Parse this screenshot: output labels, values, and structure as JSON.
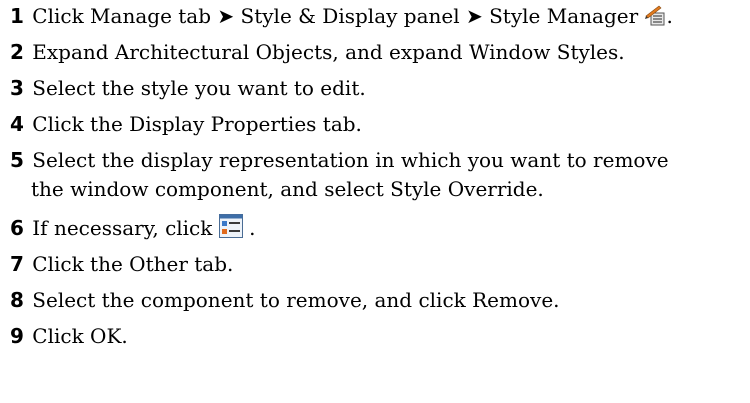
{
  "steps": [
    {
      "number": "1",
      "parts": [
        "Click Manage tab",
        "Style & Display panel",
        "Style Manager",
        "."
      ],
      "separator": "➤",
      "icon": "style-manager-icon"
    },
    {
      "number": "2",
      "text": "Expand Architectural Objects, and expand Window Styles."
    },
    {
      "number": "3",
      "text": "Select the style you want to edit."
    },
    {
      "number": "4",
      "text": "Click the Display Properties tab."
    },
    {
      "number": "5",
      "line1": "Select the display representation in which you want to remove",
      "line2": "the window component, and select Style Override."
    },
    {
      "number": "6",
      "text": "If necessary, click",
      "suffix": ".",
      "icon": "display-properties-icon"
    },
    {
      "number": "7",
      "text": "Click the Other tab."
    },
    {
      "number": "8",
      "text": "Select the component to remove, and click Remove."
    },
    {
      "number": "9",
      "text": "Click OK."
    }
  ]
}
